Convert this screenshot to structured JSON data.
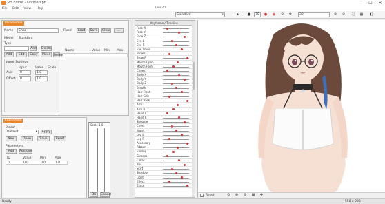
{
  "window": {
    "title": "PH Editor - Untitled.ph",
    "min_glyph": "—",
    "max_glyph": "☐",
    "close_glyph": "✕"
  },
  "menu": [
    "File",
    "Edit",
    "View",
    "Help"
  ],
  "toolbar": {
    "mode_label": "Live2D",
    "view_select": "Standard",
    "play_glyph": "▶",
    "stop_glyph": "■",
    "record_glyph": "●",
    "frame_value": "70",
    "fps_value": "30"
  },
  "left_panel": {
    "tab_label": "Parameters",
    "name_label": "Name",
    "name_value": "Char",
    "fixed_label": "Fixed",
    "btn_a": "Load",
    "btn_b": "Save",
    "btn_c": "Clear",
    "row1_label": "Model",
    "row1_value": "Standard",
    "row2_label": "Type",
    "btn_d": "Add",
    "btn_e": "Delete",
    "table_headers": [
      "Name",
      "Value",
      "Min",
      "Max"
    ],
    "btn_row": [
      "Add",
      "Edit",
      "Copy",
      "Move",
      "Delete"
    ],
    "sub_title": "Input Settings",
    "sub_headers": [
      "Input",
      "Value",
      "Scale"
    ],
    "sub_rows": [
      {
        "label": "Axis",
        "v1": "0",
        "v2": "1.0"
      },
      {
        "label": "Offset",
        "v1": "0",
        "v2": "1.0"
      }
    ]
  },
  "bottom_panel": {
    "tab_label": "Expression",
    "title": "Preset",
    "select_value": "Default",
    "btn_apply": "Apply",
    "btns": [
      "New",
      "Open",
      "Save",
      "Reset"
    ],
    "sub_title": "Parameters",
    "sub_btns": [
      "Add",
      "Remove"
    ],
    "grid_headers": [
      "ID",
      "Value",
      "Min",
      "Max"
    ],
    "grid_row": [
      "0",
      "0.0",
      "0.0",
      "1.0"
    ],
    "graph_label": "Scale 1.0",
    "foot_btns": [
      "OK",
      "Cancel"
    ]
  },
  "tracks": {
    "header": "Keyframe / Timeline",
    "rows": [
      "Face X",
      "Face Y",
      "Face Z",
      "Eye L",
      "Eye R",
      "Eye Smile",
      "Brow L",
      "Brow R",
      "Mouth Open",
      "Mouth Form",
      "Cheek",
      "Body X",
      "Body Y",
      "Body Z",
      "Breath",
      "Hair Front",
      "Hair Side",
      "Hair Back",
      "Arm L",
      "Arm R",
      "Hand L",
      "Hand R",
      "Shoulder",
      "Chest",
      "Waist",
      "Leg L",
      "Leg R",
      "Accessory",
      "Ribbon",
      "Earring",
      "Glasses",
      "Collar",
      "Tie",
      "Skirt",
      "Shadow",
      "Light",
      "Effect",
      "Extra"
    ]
  },
  "viewport": {
    "background": "#ffffff",
    "hair_color": "#6b4a3c",
    "skin_color": "#f6e0d4",
    "footer_label": "Reset"
  },
  "status": {
    "text": "Ready",
    "coords": "558 x 296"
  },
  "colors": {
    "accent": "#e8862a",
    "key_red": "#d33333"
  }
}
